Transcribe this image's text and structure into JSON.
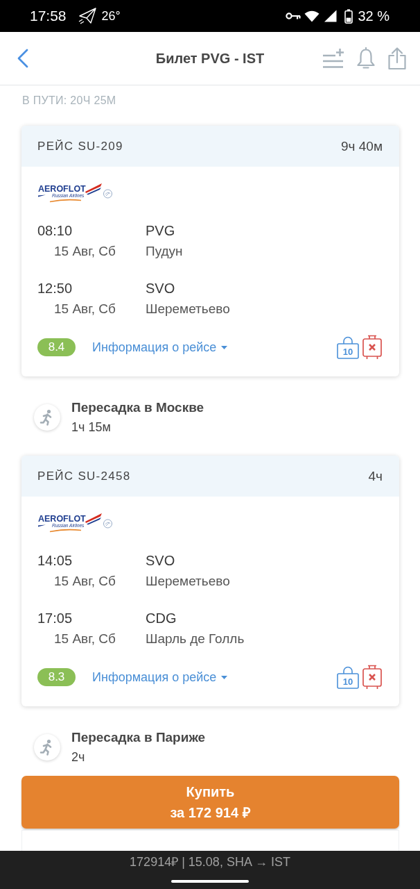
{
  "status_bar": {
    "time": "17:58",
    "temperature": "26°",
    "battery": "32 %"
  },
  "header": {
    "title": "Билет PVG - IST"
  },
  "total_duration": "В ПУТИ: 20Ч 25М",
  "itinerary": [
    {
      "kind": "flight",
      "title": "РЕЙС SU-209",
      "duration": "9ч 40м",
      "airline_logo": {
        "name": "AEROFLOT",
        "tagline": "Russian Airlines"
      },
      "segments": [
        {
          "time": "08:10",
          "date": "15 Авг, Сб",
          "code": "PVG",
          "airport": "Пудун"
        },
        {
          "time": "12:50",
          "date": "15 Авг, Сб",
          "code": "SVO",
          "airport": "Шереметьево"
        }
      ],
      "rating": "8.4",
      "info_link": "Информация о рейсе",
      "hand_baggage": "10",
      "checked_baggage": false
    },
    {
      "kind": "layover",
      "title": "Пересадка в Москве",
      "duration": "1ч 15м"
    },
    {
      "kind": "flight",
      "title": "РЕЙС SU-2458",
      "duration": "4ч",
      "airline_logo": {
        "name": "AEROFLOT",
        "tagline": "Russian Airlines"
      },
      "segments": [
        {
          "time": "14:05",
          "date": "15 Авг, Сб",
          "code": "SVO",
          "airport": "Шереметьево"
        },
        {
          "time": "17:05",
          "date": "15 Авг, Сб",
          "code": "CDG",
          "airport": "Шарль де Голль"
        }
      ],
      "rating": "8.3",
      "info_link": "Информация о рейсе",
      "hand_baggage": "10",
      "checked_baggage": false
    },
    {
      "kind": "layover",
      "title": "Пересадка в Париже",
      "duration": "2ч"
    }
  ],
  "buy_button": {
    "line_1": "Купить",
    "line_2": "за 172 914 ₽"
  },
  "nav_bar": {
    "caption": "172914₽ | 15.08, SHA → IST"
  }
}
